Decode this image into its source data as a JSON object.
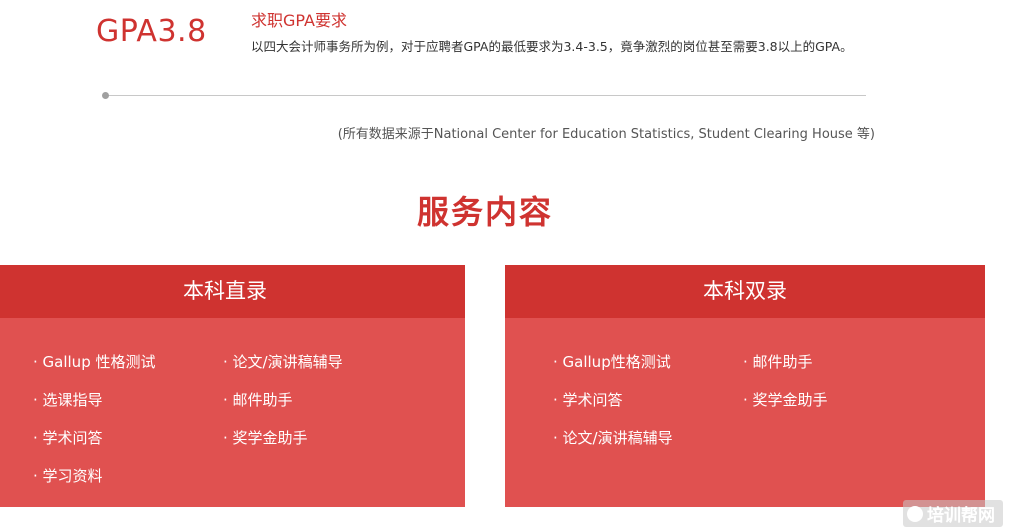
{
  "gpa": {
    "value": "GPA3.8",
    "title": "求职GPA要求",
    "description": "以四大会计师事务所为例，对于应聘者GPA的最低要求为3.4-3.5，竟争激烈的岗位甚至需要3.8以上的GPA。"
  },
  "source_note": "(所有数据来源于National Center for Education Statistics, Student Clearing House 等)",
  "section_title": "服务内容",
  "cards": [
    {
      "title": "本科直录",
      "items": [
        "· Gallup 性格测试",
        "· 论文/演讲稿辅导",
        "· 选课指导",
        "· 邮件助手",
        "· 学术问答",
        "· 奖学金助手",
        "· 学习资料"
      ]
    },
    {
      "title": "本科双录",
      "items": [
        "· Gallup性格测试",
        "· 邮件助手",
        "· 学术问答",
        "· 奖学金助手",
        "· 论文/演讲稿辅导"
      ]
    }
  ],
  "watermark": "培训帮网",
  "colors": {
    "accent": "#cf3330",
    "card_body": "#e05150"
  }
}
